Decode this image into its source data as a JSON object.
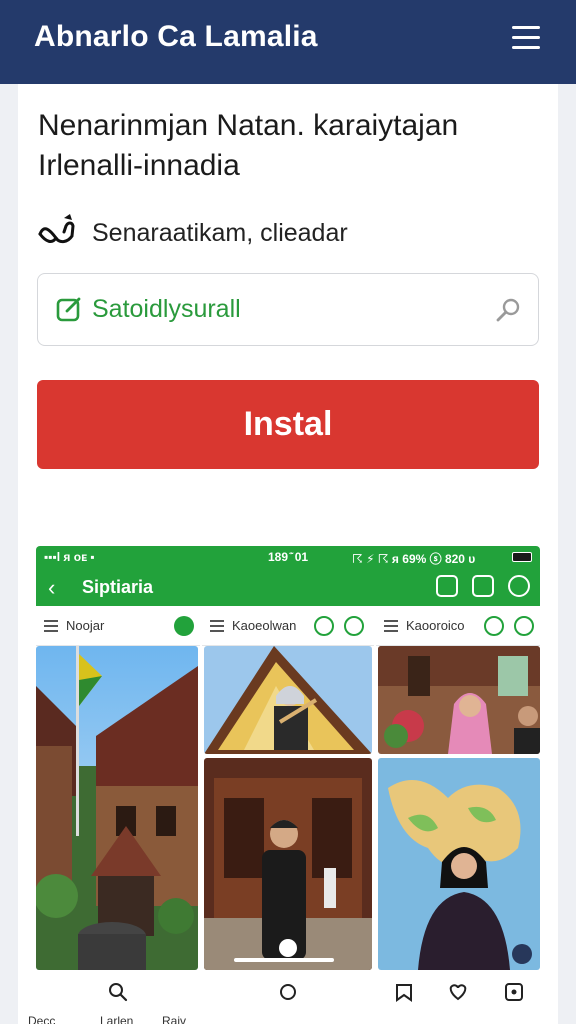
{
  "header": {
    "title": "Abnarlo Ca Lamalia",
    "menu_icon": "hamburger-menu-icon"
  },
  "main": {
    "heading_line1": "Nenarinmjan Natan. karaiytajan",
    "heading_line2": "Irlenalli-innadia",
    "subtitle": "Senaraatikam, clieadar",
    "search_value": "Satoidlysurall",
    "install_label": "Instal"
  },
  "screenshot": {
    "status_left": "▪▪▪l  ᴙ  ᴏᴇ  ▪",
    "status_mid": "189 ͊ 01",
    "status_right": "☈ ⚡ ☈  ᴙ 69%  ⓢ  820 ᴜ",
    "app_title": "Siptiaria",
    "columns": [
      {
        "label": "Noojar"
      },
      {
        "label": "Kaoeolwan"
      },
      {
        "label": "Kaooroico"
      }
    ]
  },
  "colors": {
    "header": "#243a6b",
    "install": "#d93730",
    "app_green": "#22a23b",
    "search_text": "#2a9a3c"
  },
  "bottom_nav": {
    "labels": [
      "Decc",
      "Larlen",
      "Raiv"
    ]
  }
}
